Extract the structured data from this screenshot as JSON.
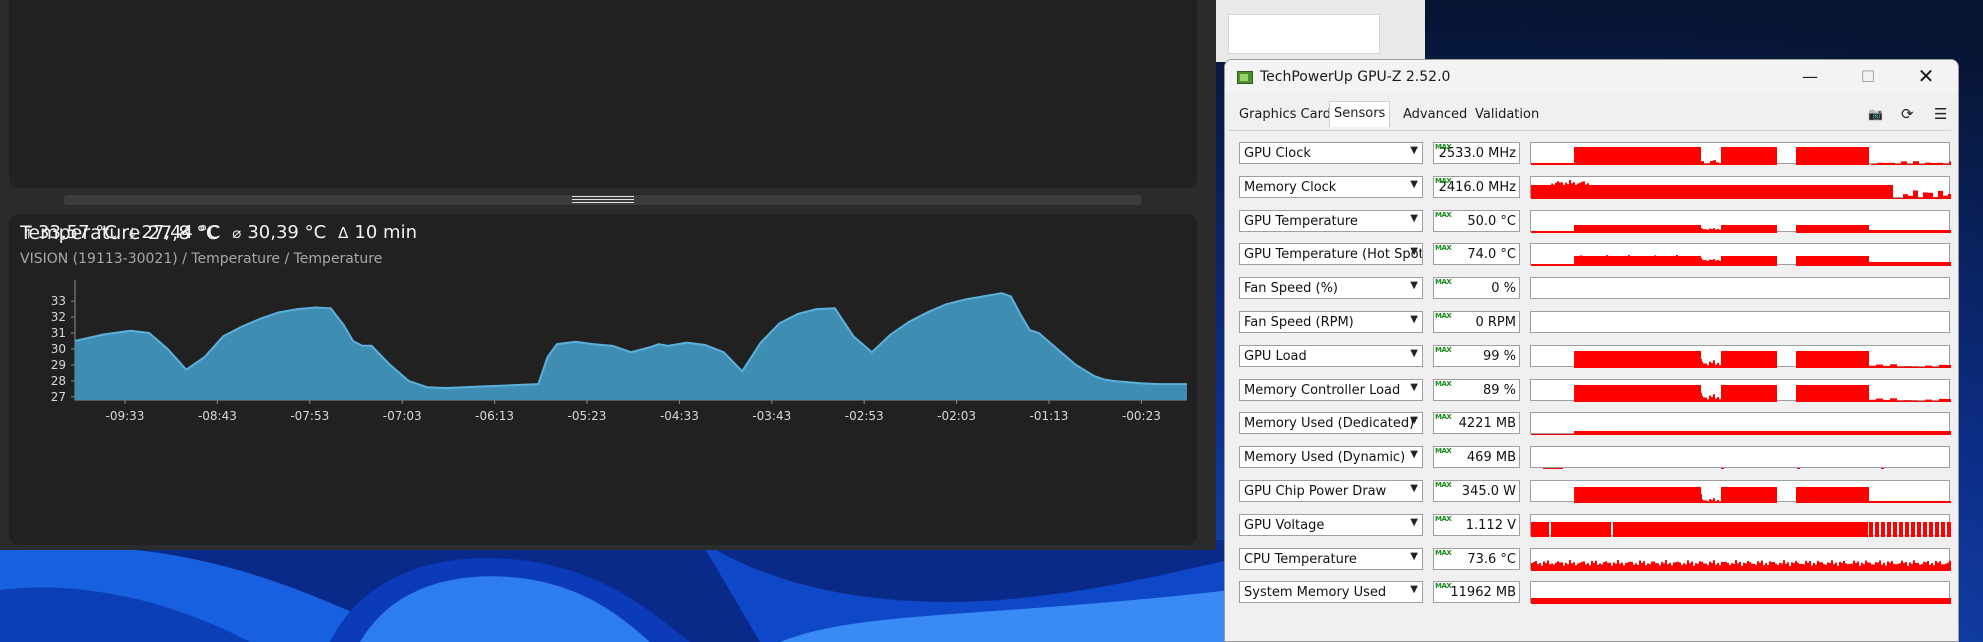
{
  "temperature_graph": {
    "title": "Temperature",
    "current": "27,8 °C",
    "max": "33,57 °C",
    "min": "27,44 °C",
    "avg": "30,39 °C",
    "interval": "10 min",
    "path": "VISION (19113-30021) / Temperature / Temperature",
    "icons": {
      "max": "max-arrow-icon",
      "min": "min-arrow-icon",
      "avg": "average-icon",
      "interval": "interval-icon"
    }
  },
  "chart_data": {
    "type": "area",
    "x_labels": [
      "-09:33",
      "-08:43",
      "-07:53",
      "-07:03",
      "-06:13",
      "-05:23",
      "-04:33",
      "-03:43",
      "-02:53",
      "-02:03",
      "-01:13",
      "-00:23"
    ],
    "y_ticks": [
      27,
      28,
      29,
      30,
      31,
      32,
      33
    ],
    "ylim": [
      26.8,
      33.7
    ],
    "x_range_seconds": [
      -600,
      0
    ],
    "values_x_seconds": [
      -600,
      -585,
      -570,
      -560,
      -550,
      -540,
      -530,
      -520,
      -510,
      -500,
      -490,
      -480,
      -470,
      -462,
      -455,
      -450,
      -445,
      -440,
      -430,
      -420,
      -410,
      -400,
      -390,
      -380,
      -370,
      -360,
      -350,
      -345,
      -340,
      -330,
      -320,
      -310,
      -300,
      -290,
      -285,
      -280,
      -270,
      -260,
      -250,
      -240,
      -230,
      -220,
      -210,
      -200,
      -190,
      -180,
      -170,
      -160,
      -150,
      -140,
      -130,
      -120,
      -110,
      -105,
      -100,
      -95,
      -90,
      -85,
      -80,
      -70,
      -60,
      -50,
      -45,
      -40,
      -35,
      -30,
      -25,
      -20,
      -15,
      -10,
      -5,
      0
    ],
    "values": [
      30.5,
      30.9,
      31.15,
      31.0,
      30.0,
      28.7,
      29.5,
      30.8,
      31.4,
      31.9,
      32.3,
      32.5,
      32.6,
      32.55,
      31.5,
      30.5,
      30.2,
      30.2,
      29.0,
      28.0,
      27.6,
      27.55,
      27.6,
      27.65,
      27.7,
      27.75,
      27.8,
      29.5,
      30.3,
      30.45,
      30.3,
      30.2,
      29.8,
      30.1,
      30.3,
      30.2,
      30.4,
      30.25,
      29.8,
      28.6,
      30.4,
      31.6,
      32.2,
      32.5,
      32.55,
      30.8,
      29.8,
      30.9,
      31.7,
      32.3,
      32.8,
      33.1,
      33.3,
      33.4,
      33.5,
      33.3,
      32.2,
      31.2,
      31.0,
      30.0,
      29.0,
      28.3,
      28.1,
      28.0,
      27.95,
      27.9,
      27.85,
      27.82,
      27.8,
      27.8,
      27.8,
      27.8
    ],
    "color": "#3f8db2",
    "line_color": "#5cb0dc",
    "grid": false
  },
  "gpuz": {
    "title": "TechPowerUp GPU-Z 2.52.0",
    "tabs": [
      "Graphics Card",
      "Sensors",
      "Advanced",
      "Validation"
    ],
    "active_tab": "Sensors",
    "max_tag": "MAX",
    "toolbar_icons": [
      "camera-icon",
      "refresh-icon",
      "menu-icon"
    ],
    "sensor_color": "#ff0000",
    "sensors": [
      {
        "name": "GPU Clock",
        "value": "2533.0 MHz",
        "pattern": "clock"
      },
      {
        "name": "Memory Clock",
        "value": "2416.0 MHz",
        "pattern": "memclock"
      },
      {
        "name": "GPU Temperature",
        "value": "50.0 °C",
        "pattern": "temp"
      },
      {
        "name": "GPU Temperature (Hot Spot)",
        "value": "74.0 °C",
        "pattern": "hotspot"
      },
      {
        "name": "Fan Speed (%)",
        "value": "0 %",
        "pattern": "empty"
      },
      {
        "name": "Fan Speed (RPM)",
        "value": "0 RPM",
        "pattern": "empty"
      },
      {
        "name": "GPU Load",
        "value": "99 %",
        "pattern": "load"
      },
      {
        "name": "Memory Controller Load",
        "value": "89 %",
        "pattern": "load"
      },
      {
        "name": "Memory Used (Dedicated)",
        "value": "4221 MB",
        "pattern": "memused"
      },
      {
        "name": "Memory Used (Dynamic)",
        "value": "469 MB",
        "pattern": "dynamic"
      },
      {
        "name": "GPU Chip Power Draw",
        "value": "345.0 W",
        "pattern": "power"
      },
      {
        "name": "GPU Voltage",
        "value": "1.112 V",
        "pattern": "voltage"
      },
      {
        "name": "CPU Temperature",
        "value": "73.6 °C",
        "pattern": "cputemp"
      },
      {
        "name": "System Memory Used",
        "value": "11962 MB",
        "pattern": "sysmem"
      }
    ]
  }
}
